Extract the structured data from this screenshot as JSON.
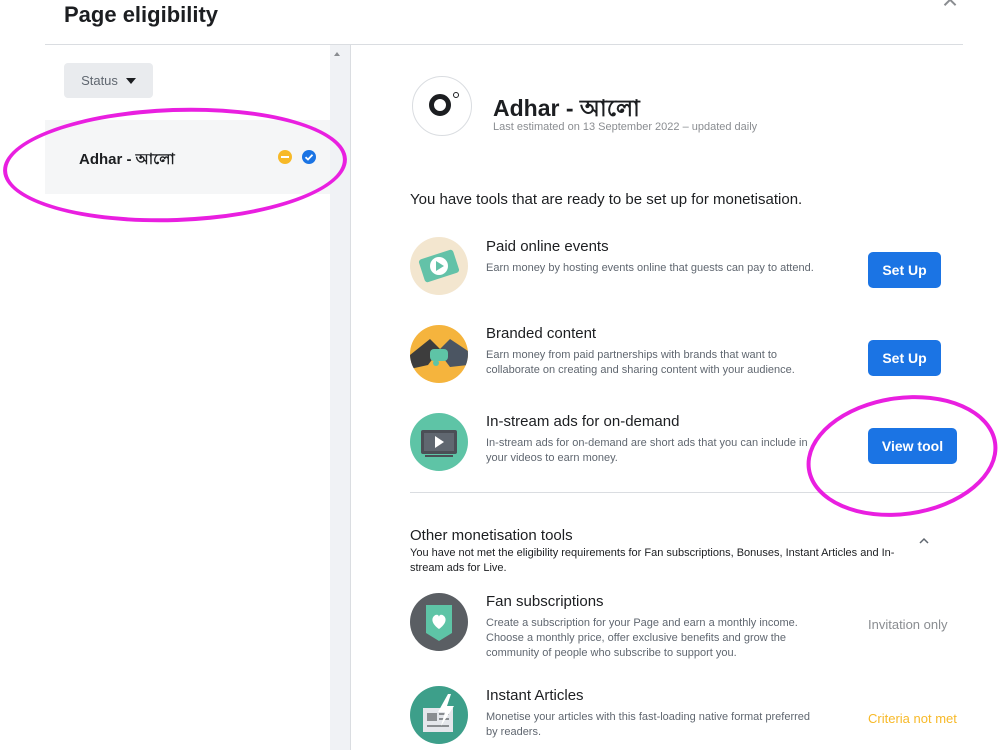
{
  "header": {
    "title": "Page eligibility",
    "close_icon": "×"
  },
  "sidebar": {
    "status_label": "Status",
    "page_item": {
      "label": "Adhar - আলো"
    }
  },
  "page": {
    "name": "Adhar - আলো",
    "last_estimated": "Last estimated on 13 September 2022 – updated daily"
  },
  "ready_heading": "You have tools that are ready to be set up for monetisation.",
  "tools": [
    {
      "title": "Paid online events",
      "desc": "Earn money by hosting events online that guests can pay to attend.",
      "button": "Set Up",
      "icon": "ticket-icon"
    },
    {
      "title": "Branded content",
      "desc": "Earn money from paid partnerships with brands that want to collaborate on creating and sharing content with your audience.",
      "button": "Set Up",
      "icon": "handshake-icon"
    },
    {
      "title": "In-stream ads for on-demand",
      "desc": "In-stream ads for on-demand are short ads that you can include in your videos to earn money.",
      "button": "View tool",
      "icon": "video-icon"
    }
  ],
  "other": {
    "title": "Other monetisation tools",
    "desc": "You have not met the eligibility requirements for Fan subscriptions, Bonuses, Instant Articles and In-stream ads for Live.",
    "items": [
      {
        "title": "Fan subscriptions",
        "desc": "Create a subscription for your Page and earn a monthly income. Choose a monthly price, offer exclusive benefits and grow the community of people who subscribe to support you.",
        "status": "Invitation only",
        "icon": "heart-badge-icon"
      },
      {
        "title": "Instant Articles",
        "desc": "Monetise your articles with this fast-loading native format preferred by readers.",
        "status": "Criteria not met",
        "icon": "lightning-article-icon"
      }
    ]
  },
  "colors": {
    "accent": "#1b74e4",
    "warning": "#f7b928",
    "annotation": "#e91fe0"
  }
}
